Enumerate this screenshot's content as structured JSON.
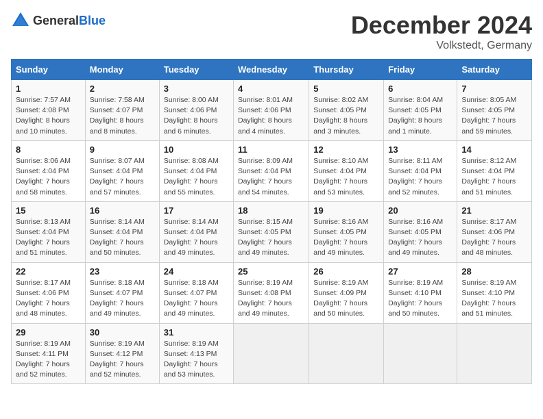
{
  "header": {
    "logo_general": "General",
    "logo_blue": "Blue",
    "title": "December 2024",
    "subtitle": "Volkstedt, Germany"
  },
  "weekdays": [
    "Sunday",
    "Monday",
    "Tuesday",
    "Wednesday",
    "Thursday",
    "Friday",
    "Saturday"
  ],
  "weeks": [
    [
      {
        "day": "1",
        "sunrise": "Sunrise: 7:57 AM",
        "sunset": "Sunset: 4:08 PM",
        "daylight": "Daylight: 8 hours and 10 minutes."
      },
      {
        "day": "2",
        "sunrise": "Sunrise: 7:58 AM",
        "sunset": "Sunset: 4:07 PM",
        "daylight": "Daylight: 8 hours and 8 minutes."
      },
      {
        "day": "3",
        "sunrise": "Sunrise: 8:00 AM",
        "sunset": "Sunset: 4:06 PM",
        "daylight": "Daylight: 8 hours and 6 minutes."
      },
      {
        "day": "4",
        "sunrise": "Sunrise: 8:01 AM",
        "sunset": "Sunset: 4:06 PM",
        "daylight": "Daylight: 8 hours and 4 minutes."
      },
      {
        "day": "5",
        "sunrise": "Sunrise: 8:02 AM",
        "sunset": "Sunset: 4:05 PM",
        "daylight": "Daylight: 8 hours and 3 minutes."
      },
      {
        "day": "6",
        "sunrise": "Sunrise: 8:04 AM",
        "sunset": "Sunset: 4:05 PM",
        "daylight": "Daylight: 8 hours and 1 minute."
      },
      {
        "day": "7",
        "sunrise": "Sunrise: 8:05 AM",
        "sunset": "Sunset: 4:05 PM",
        "daylight": "Daylight: 7 hours and 59 minutes."
      }
    ],
    [
      {
        "day": "8",
        "sunrise": "Sunrise: 8:06 AM",
        "sunset": "Sunset: 4:04 PM",
        "daylight": "Daylight: 7 hours and 58 minutes."
      },
      {
        "day": "9",
        "sunrise": "Sunrise: 8:07 AM",
        "sunset": "Sunset: 4:04 PM",
        "daylight": "Daylight: 7 hours and 57 minutes."
      },
      {
        "day": "10",
        "sunrise": "Sunrise: 8:08 AM",
        "sunset": "Sunset: 4:04 PM",
        "daylight": "Daylight: 7 hours and 55 minutes."
      },
      {
        "day": "11",
        "sunrise": "Sunrise: 8:09 AM",
        "sunset": "Sunset: 4:04 PM",
        "daylight": "Daylight: 7 hours and 54 minutes."
      },
      {
        "day": "12",
        "sunrise": "Sunrise: 8:10 AM",
        "sunset": "Sunset: 4:04 PM",
        "daylight": "Daylight: 7 hours and 53 minutes."
      },
      {
        "day": "13",
        "sunrise": "Sunrise: 8:11 AM",
        "sunset": "Sunset: 4:04 PM",
        "daylight": "Daylight: 7 hours and 52 minutes."
      },
      {
        "day": "14",
        "sunrise": "Sunrise: 8:12 AM",
        "sunset": "Sunset: 4:04 PM",
        "daylight": "Daylight: 7 hours and 51 minutes."
      }
    ],
    [
      {
        "day": "15",
        "sunrise": "Sunrise: 8:13 AM",
        "sunset": "Sunset: 4:04 PM",
        "daylight": "Daylight: 7 hours and 51 minutes."
      },
      {
        "day": "16",
        "sunrise": "Sunrise: 8:14 AM",
        "sunset": "Sunset: 4:04 PM",
        "daylight": "Daylight: 7 hours and 50 minutes."
      },
      {
        "day": "17",
        "sunrise": "Sunrise: 8:14 AM",
        "sunset": "Sunset: 4:04 PM",
        "daylight": "Daylight: 7 hours and 49 minutes."
      },
      {
        "day": "18",
        "sunrise": "Sunrise: 8:15 AM",
        "sunset": "Sunset: 4:05 PM",
        "daylight": "Daylight: 7 hours and 49 minutes."
      },
      {
        "day": "19",
        "sunrise": "Sunrise: 8:16 AM",
        "sunset": "Sunset: 4:05 PM",
        "daylight": "Daylight: 7 hours and 49 minutes."
      },
      {
        "day": "20",
        "sunrise": "Sunrise: 8:16 AM",
        "sunset": "Sunset: 4:05 PM",
        "daylight": "Daylight: 7 hours and 49 minutes."
      },
      {
        "day": "21",
        "sunrise": "Sunrise: 8:17 AM",
        "sunset": "Sunset: 4:06 PM",
        "daylight": "Daylight: 7 hours and 48 minutes."
      }
    ],
    [
      {
        "day": "22",
        "sunrise": "Sunrise: 8:17 AM",
        "sunset": "Sunset: 4:06 PM",
        "daylight": "Daylight: 7 hours and 48 minutes."
      },
      {
        "day": "23",
        "sunrise": "Sunrise: 8:18 AM",
        "sunset": "Sunset: 4:07 PM",
        "daylight": "Daylight: 7 hours and 49 minutes."
      },
      {
        "day": "24",
        "sunrise": "Sunrise: 8:18 AM",
        "sunset": "Sunset: 4:07 PM",
        "daylight": "Daylight: 7 hours and 49 minutes."
      },
      {
        "day": "25",
        "sunrise": "Sunrise: 8:19 AM",
        "sunset": "Sunset: 4:08 PM",
        "daylight": "Daylight: 7 hours and 49 minutes."
      },
      {
        "day": "26",
        "sunrise": "Sunrise: 8:19 AM",
        "sunset": "Sunset: 4:09 PM",
        "daylight": "Daylight: 7 hours and 50 minutes."
      },
      {
        "day": "27",
        "sunrise": "Sunrise: 8:19 AM",
        "sunset": "Sunset: 4:10 PM",
        "daylight": "Daylight: 7 hours and 50 minutes."
      },
      {
        "day": "28",
        "sunrise": "Sunrise: 8:19 AM",
        "sunset": "Sunset: 4:10 PM",
        "daylight": "Daylight: 7 hours and 51 minutes."
      }
    ],
    [
      {
        "day": "29",
        "sunrise": "Sunrise: 8:19 AM",
        "sunset": "Sunset: 4:11 PM",
        "daylight": "Daylight: 7 hours and 52 minutes."
      },
      {
        "day": "30",
        "sunrise": "Sunrise: 8:19 AM",
        "sunset": "Sunset: 4:12 PM",
        "daylight": "Daylight: 7 hours and 52 minutes."
      },
      {
        "day": "31",
        "sunrise": "Sunrise: 8:19 AM",
        "sunset": "Sunset: 4:13 PM",
        "daylight": "Daylight: 7 hours and 53 minutes."
      },
      null,
      null,
      null,
      null
    ]
  ]
}
